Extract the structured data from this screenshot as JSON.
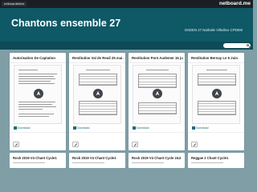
{
  "topbar": {
    "tag": "netboardeleve",
    "brand": "netboard.me"
  },
  "header": {
    "title": "Chantons ensemble 27",
    "subtitle": "DSDEN 27 Nathalie Villedieu CPDEM"
  },
  "search": {
    "placeholder": ""
  },
  "columns": [
    {
      "title": "Autorisation De Captation",
      "download": "Download"
    },
    {
      "title": "Restitution Val de Reuil 25 mai  4 juin",
      "download": "Download"
    },
    {
      "title": "Restitution Pont Audemer 16 juin",
      "download": "Download"
    },
    {
      "title": "Restitution Bernay Le 5 Juin",
      "download": "Download"
    }
  ],
  "lower_columns": [
    {
      "title": "Rock 2019 V4 Chant Cycle1"
    },
    {
      "title": "Rock 2019 V4 Chant Cycle1"
    },
    {
      "title": "Rock 2019 V4 Chant Cycle 2&3"
    },
    {
      "title": "Reggae 2 Chant Cycle1"
    }
  ]
}
